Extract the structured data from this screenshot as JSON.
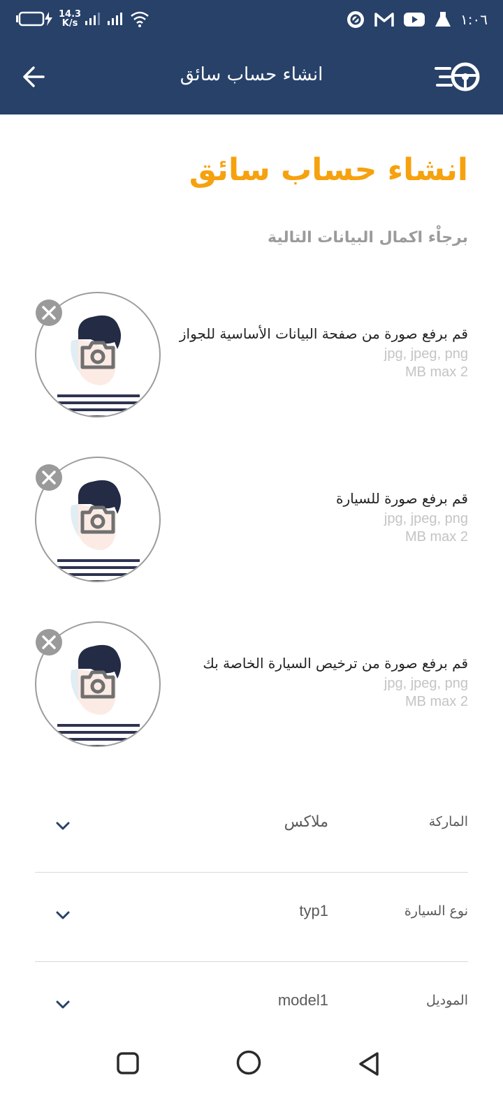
{
  "status_bar": {
    "net_speed_value": "14.3",
    "net_speed_unit": "K/s",
    "time": "١:٠٦"
  },
  "top_bar": {
    "title": "انشاء حساب سائق"
  },
  "main": {
    "title": "انشاء حساب سائق",
    "subtitle": "برجاْء اكمال البيانات التالية"
  },
  "uploads": [
    {
      "label": "قم برفع صورة من صفحة البيانات الأساسية للجواز",
      "formats": "jpg, jpeg, png",
      "max_size": "MB max 2"
    },
    {
      "label": "قم برفع صورة للسيارة",
      "formats": "jpg, jpeg, png",
      "max_size": "MB max 2"
    },
    {
      "label": "قم برفع صورة من ترخيص السيارة الخاصة بك",
      "formats": "jpg, jpeg, png",
      "max_size": "MB max 2"
    }
  ],
  "fields": [
    {
      "label": "الماركة",
      "value": "ملاكس"
    },
    {
      "label": "نوع السيارة",
      "value": "typ1"
    },
    {
      "label": "الموديل",
      "value": "model1"
    }
  ],
  "colors": {
    "primary": "#274169",
    "accent": "#f6a10e"
  }
}
